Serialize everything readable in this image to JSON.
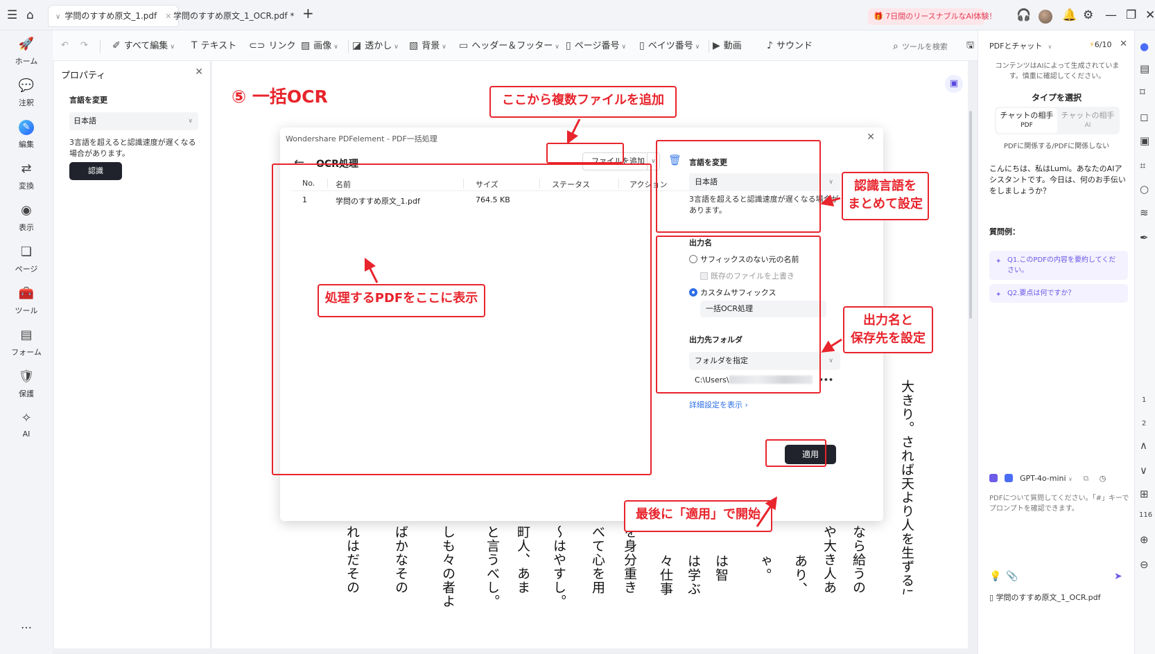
{
  "titlebar": {
    "tabs": [
      {
        "label": "学問のすすめ原文_1.pdf",
        "active": true
      },
      {
        "label": "学問のすすめ原文_1_OCR.pdf *",
        "active": false
      }
    ],
    "promo": "7日間のリースナブルなAI体験！",
    "icons": [
      "menu-icon",
      "home-icon",
      "add-tab-icon",
      "gift-icon",
      "headset-icon",
      "bell-icon",
      "gear-icon",
      "minimize-icon",
      "restore-icon",
      "close-icon"
    ]
  },
  "toolbar": {
    "items": [
      {
        "label": "すべて編集",
        "icon": "edit-all-icon",
        "dropdown": true
      },
      {
        "label": "テキスト",
        "icon": "text-icon"
      },
      {
        "label": "リンク",
        "icon": "link-icon"
      },
      {
        "label": "画像",
        "icon": "image-icon",
        "dropdown": true
      },
      {
        "label": "透かし",
        "icon": "watermark-icon",
        "dropdown": true
      },
      {
        "label": "背景",
        "icon": "background-icon",
        "dropdown": true
      },
      {
        "label": "ヘッダー＆フッター",
        "icon": "header-footer-icon",
        "dropdown": true
      },
      {
        "label": "ページ番号",
        "icon": "page-number-icon",
        "dropdown": true
      },
      {
        "label": "ベイツ番号",
        "icon": "bates-number-icon",
        "dropdown": true
      },
      {
        "label": "動画",
        "icon": "video-icon"
      },
      {
        "label": "サウンド",
        "icon": "sound-icon"
      }
    ],
    "search_tools": "ツールを検索"
  },
  "leftnav": [
    {
      "label": "ホーム",
      "icon": "rocket-icon"
    },
    {
      "label": "注釈",
      "icon": "comment-icon"
    },
    {
      "label": "編集",
      "icon": "edit-icon",
      "active": true
    },
    {
      "label": "変換",
      "icon": "convert-icon"
    },
    {
      "label": "表示",
      "icon": "view-icon"
    },
    {
      "label": "ページ",
      "icon": "pages-icon"
    },
    {
      "label": "ツール",
      "icon": "toolbox-icon"
    },
    {
      "label": "フォーム",
      "icon": "form-icon"
    },
    {
      "label": "保護",
      "icon": "shield-icon"
    },
    {
      "label": "AI",
      "icon": "magic-wand-icon"
    },
    {
      "label": "…",
      "icon": "more-icon"
    }
  ],
  "properties": {
    "title": "プロパティ",
    "language_label": "言語を変更",
    "language_value": "日本語",
    "note": "3言語を超えると認識速度が遅くなる場合があります。",
    "recognize_button": "認識"
  },
  "document": {
    "step_title": "⑤ 一括OCR",
    "columns": [
      "れはだその",
      "ばかなその",
      "しも々の者よ",
      "と言うべし。",
      "町人、あま",
      "～はやすし。",
      "べて心を用",
      "を身分重き",
      "々仕事",
      "は学ぶ",
      "は智",
      "ゃ。",
      "あり、",
      "や大き人あ",
      "なら給うの",
      "大きり。されば天より人を生ずるには、万人は万人みな同じ位にして、生まれながら貴賤上下の差別なく、万物の霊たる身と心との働きをもって天地の"
    ]
  },
  "dialog": {
    "app_title": "Wondershare PDFelement - PDF一括処理",
    "heading": "OCR処理",
    "add_file": "ファイルを追加",
    "table": {
      "headers": [
        "No.",
        "名前",
        "サイズ",
        "ステータス",
        "アクション"
      ],
      "rows": [
        {
          "no": "1",
          "name": "学問のすすめ原文_1.pdf",
          "size": "764.5 KB",
          "status": "",
          "action": ""
        }
      ]
    },
    "language_label": "言語を変更",
    "language_value": "日本語",
    "language_note": "3言語を超えると認識速度が遅くなる場合があります。",
    "output_name_label": "出力名",
    "option_original": "サフィックスのない元の名前",
    "option_overwrite": "既存のファイルを上書き",
    "option_custom": "カスタムサフィックス",
    "custom_suffix_value": "一括OCR処理",
    "output_folder_label": "出力先フォルダ",
    "folder_select": "フォルダを指定",
    "folder_path_prefix": "C:\\Users\\",
    "advanced_link": "詳細設定を表示 ›",
    "apply_button": "適用"
  },
  "annotations": {
    "add_files": "ここから複数ファイルを追加",
    "show_pdfs": "処理するPDFをここに表示",
    "language_1": "認識言語を",
    "language_2": "まとめて設定",
    "output_1": "出力名と",
    "output_2": "保存先を設定",
    "apply_last": "最後に「適用」で開始",
    "accent_color": "#e8242c"
  },
  "chat": {
    "title": "PDFとチャット",
    "count": "6/10",
    "disclaimer": "コンテンツはAIによって生成されています。慎重に確認してください。",
    "type_heading": "タイプを選択",
    "options": [
      {
        "label": "チャットの相手",
        "sub": "PDF",
        "active": true
      },
      {
        "label": "チャットの相手",
        "sub": "AI",
        "active": false
      }
    ],
    "subtext": "PDFに関係する/PDFに関係しない",
    "greeting": "こんにちは、私はLumi。あなたのAIアシスタントです。今日は、何のお手伝いをしましょうか？",
    "examples_heading": "質問例：",
    "examples": [
      "Q1.このPDFの内容を要約してください。",
      "Q2.要点は何ですか？"
    ],
    "model": "GPT-4o-mini",
    "input_placeholder": "PDFについて質問してください。「#」キーでプロンプトを確認できます。",
    "file": "学問のすすめ原文_1_OCR.pdf"
  },
  "farright": {
    "page_numbers": [
      "1",
      "2"
    ],
    "zoom": "116"
  }
}
